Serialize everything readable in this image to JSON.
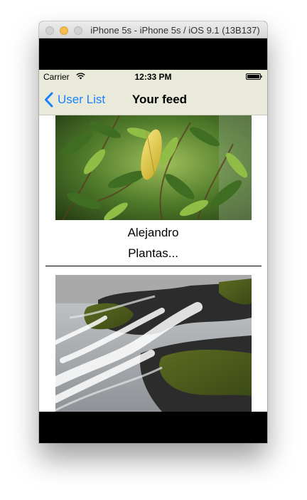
{
  "window": {
    "title": "iPhone 5s - iPhone 5s / iOS 9.1 (13B137)"
  },
  "status_bar": {
    "carrier": "Carrier",
    "time": "12:33 PM",
    "wifi_icon": "wifi-icon",
    "battery_icon": "battery-icon"
  },
  "nav": {
    "back_label": "User List",
    "back_icon": "chevron-left-icon",
    "title": "Your feed",
    "tint_color": "#1a82fb",
    "bar_color": "#eaeadb"
  },
  "feed": {
    "posts": [
      {
        "image": "leaves-photo",
        "author": "Alejandro",
        "caption": "Plantas..."
      },
      {
        "image": "waterfall-photo",
        "author": "",
        "caption": ""
      }
    ]
  }
}
